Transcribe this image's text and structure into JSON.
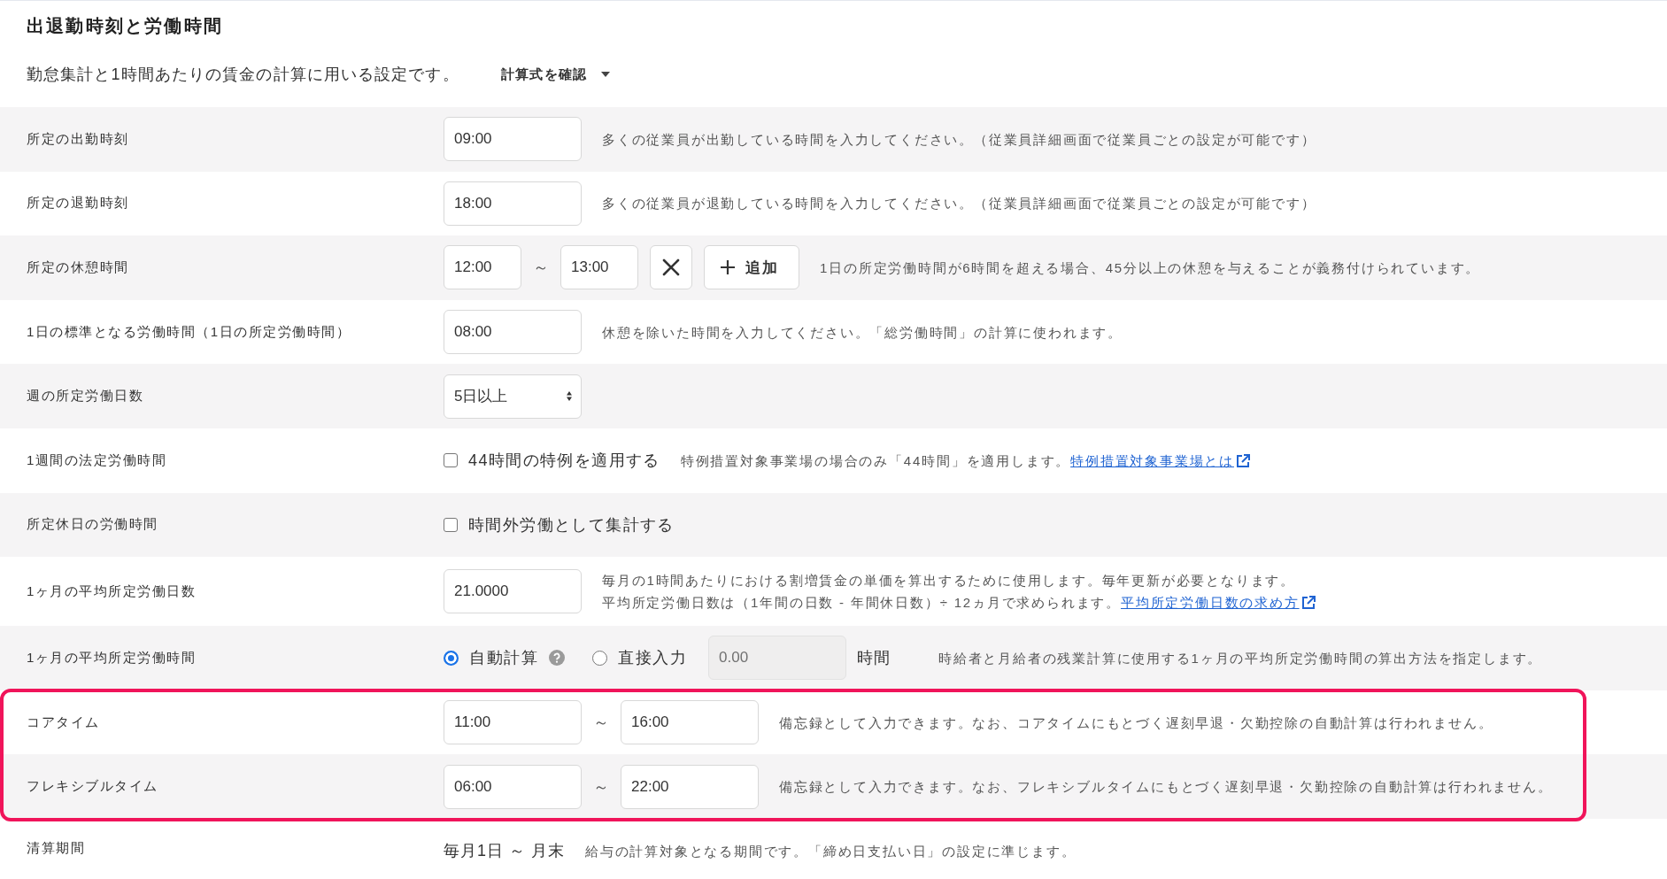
{
  "section": {
    "title": "出退勤時刻と労働時間",
    "description": "勤怠集計と1時間あたりの賃金の計算に用いる設定です。",
    "formula_toggle": {
      "label": "計算式を確認",
      "expanded": false
    }
  },
  "rows": [
    {
      "kind": "time",
      "label": "所定の出勤時刻",
      "value": "09:00",
      "note": "多くの従業員が出勤している時間を入力してください。（従業員詳細画面で従業員ごとの設定が可能です）",
      "highlighted": false
    },
    {
      "kind": "time",
      "label": "所定の退勤時刻",
      "value": "18:00",
      "note": "多くの従業員が退勤している時間を入力してください。（従業員詳細画面で従業員ごとの設定が可能です）",
      "highlighted": false
    },
    {
      "kind": "break_range",
      "label": "所定の休憩時間",
      "from": "12:00",
      "separator": "～",
      "to": "13:00",
      "removable": true,
      "add_button": "追加",
      "note": "1日の所定労働時間が6時間を超える場合、45分以上の休憩を与えることが義務付けられています。",
      "highlighted": false
    },
    {
      "kind": "time",
      "label": "1日の標準となる労働時間（1日の所定労働時間）",
      "value": "08:00",
      "note": "休憩を除いた時間を入力してください。「総労働時間」の計算に使われます。",
      "highlighted": false
    },
    {
      "kind": "select",
      "label": "週の所定労働日数",
      "value": "5日以上",
      "highlighted": false
    },
    {
      "kind": "checkbox",
      "label": "1週間の法定労働時間",
      "option": {
        "label": "44時間の特例を適用する",
        "checked": false
      },
      "note": "特例措置対象事業場の場合のみ「44時間」を適用します。",
      "link": "特例措置対象事業場とは",
      "highlighted": false
    },
    {
      "kind": "checkbox",
      "label": "所定休日の労働時間",
      "option": {
        "label": "時間外労働として集計する",
        "checked": false
      },
      "highlighted": false
    },
    {
      "kind": "number",
      "label": "1ヶ月の平均所定労働日数",
      "value": "21.0000",
      "note_lines": [
        "毎月の1時間あたりにおける割増賃金の単価を算出するために使用します。毎年更新が必要となります。",
        "平均所定労働日数は（1年間の日数 - 年間休日数）÷ 12ヵ月で求められます。"
      ],
      "link": "平均所定労働日数の求め方",
      "highlighted": false
    },
    {
      "kind": "radio",
      "label": "1ヶ月の平均所定労働時間",
      "options": [
        {
          "label": "自動計算",
          "selected": true,
          "help": true
        },
        {
          "label": "直接入力",
          "selected": false,
          "help": false
        }
      ],
      "input": {
        "value": "0.00",
        "disabled": true
      },
      "unit": "時間",
      "note": "時給者と月給者の残業計算に使用する1ヶ月の平均所定労働時間の算出方法を指定します。",
      "highlighted": false
    },
    {
      "kind": "time_range",
      "label": "コアタイム",
      "from": "11:00",
      "separator": "～",
      "to": "16:00",
      "note": "備忘録として入力できます。なお、コアタイムにもとづく遅刻早退・欠勤控除の自動計算は行われません。",
      "highlighted": true
    },
    {
      "kind": "time_range",
      "label": "フレキシブルタイム",
      "from": "06:00",
      "separator": "～",
      "to": "22:00",
      "note": "備忘録として入力できます。なお、フレキシブルタイムにもとづく遅刻早退・欠勤控除の自動計算は行われません。",
      "highlighted": true
    },
    {
      "kind": "text",
      "label": "清算期間",
      "value": "毎月1日 ～ 月末",
      "note": "給与の計算対象となる期間です。「締め日支払い日」の設定に準じます。",
      "highlighted": false
    }
  ]
}
